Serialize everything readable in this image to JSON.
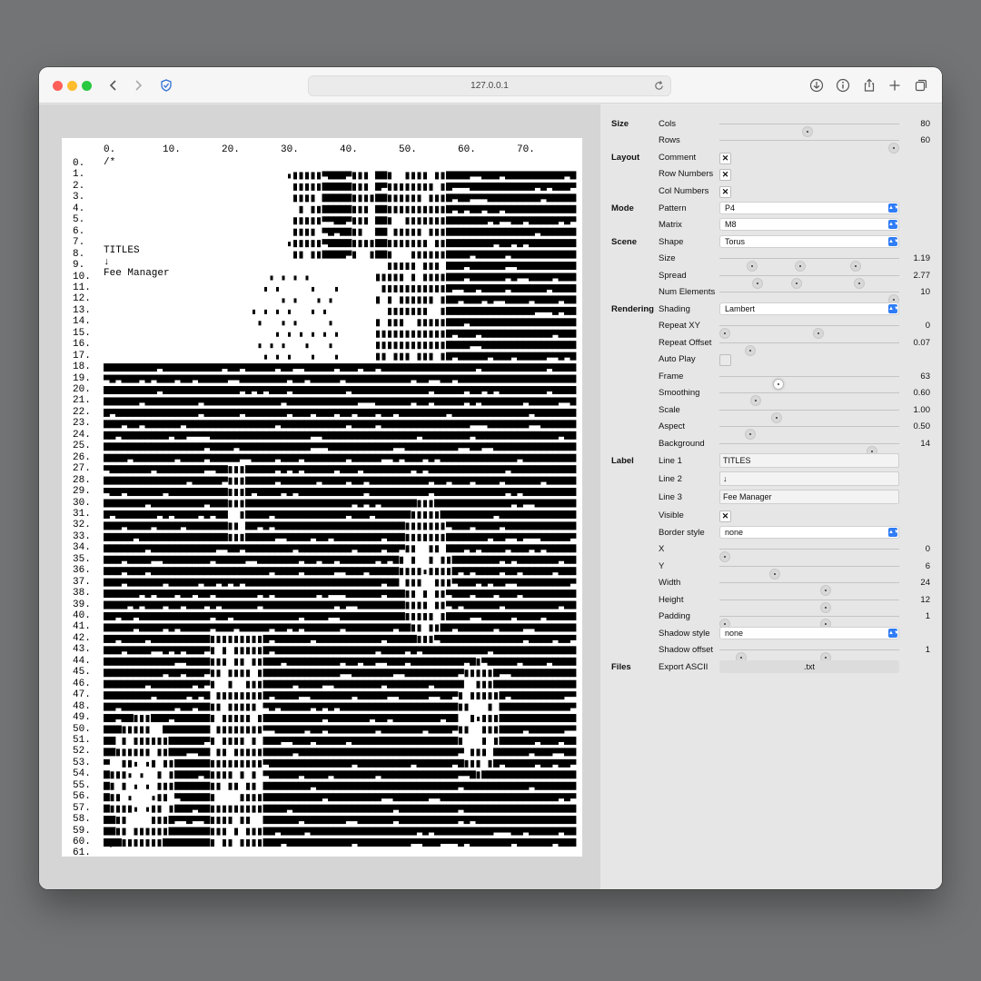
{
  "browser": {
    "url": "127.0.0.1"
  },
  "canvas": {
    "col_ticks": [
      "0.",
      "10.",
      "20.",
      "30.",
      "40.",
      "50.",
      "60.",
      "70."
    ],
    "row_numbers": [
      "0.",
      "1.",
      "2.",
      "3.",
      "4.",
      "5.",
      "6.",
      "7.",
      "8.",
      "9.",
      "10.",
      "11.",
      "12.",
      "13.",
      "14.",
      "15.",
      "16.",
      "17.",
      "18.",
      "19.",
      "20.",
      "21.",
      "22.",
      "23.",
      "24.",
      "25.",
      "26.",
      "27.",
      "28.",
      "29.",
      "30.",
      "31.",
      "32.",
      "33.",
      "34.",
      "35.",
      "36.",
      "37.",
      "38.",
      "39.",
      "40.",
      "41.",
      "42.",
      "43.",
      "44.",
      "45.",
      "46.",
      "47.",
      "48.",
      "49.",
      "50.",
      "51.",
      "52.",
      "53.",
      "54.",
      "55.",
      "56.",
      "57.",
      "58.",
      "59.",
      "60.",
      "61."
    ],
    "comment_open": "/*",
    "comment_close": "*/",
    "label_line1": "TITLES",
    "label_line2": "↓",
    "label_line3": "Fee Manager"
  },
  "panel": {
    "size": {
      "section": "Size",
      "cols": {
        "label": "Cols",
        "value": "80"
      },
      "rows": {
        "label": "Rows",
        "value": "60"
      }
    },
    "layout": {
      "section": "Layout",
      "comment": {
        "label": "Comment",
        "checked": true
      },
      "row_numbers": {
        "label": "Row Numbers",
        "checked": true
      },
      "col_numbers": {
        "label": "Col Numbers",
        "checked": true
      }
    },
    "mode": {
      "section": "Mode",
      "pattern": {
        "label": "Pattern",
        "value": "P4"
      },
      "matrix": {
        "label": "Matrix",
        "value": "M8"
      }
    },
    "scene": {
      "section": "Scene",
      "shape": {
        "label": "Shape",
        "value": "Torus"
      },
      "size": {
        "label": "Size",
        "value": "1.19"
      },
      "spread": {
        "label": "Spread",
        "value": "2.77"
      },
      "num_elements": {
        "label": "Num Elements",
        "value": "10"
      }
    },
    "rendering": {
      "section": "Rendering",
      "shading": {
        "label": "Shading",
        "value": "Lambert"
      },
      "repeat_xy": {
        "label": "Repeat XY",
        "value": "0"
      },
      "repeat_offset": {
        "label": "Repeat Offset",
        "value": "0.07"
      },
      "auto_play": {
        "label": "Auto Play",
        "checked": false
      },
      "frame": {
        "label": "Frame",
        "value": "63"
      },
      "smoothing": {
        "label": "Smoothing",
        "value": "0.60"
      },
      "scale": {
        "label": "Scale",
        "value": "1.00"
      },
      "aspect": {
        "label": "Aspect",
        "value": "0.50"
      },
      "background": {
        "label": "Background",
        "value": "14"
      }
    },
    "label": {
      "section": "Label",
      "line1": {
        "label": "Line 1",
        "value": "TITLES"
      },
      "line2": {
        "label": "Line 2",
        "value": "↓"
      },
      "line3": {
        "label": "Line 3",
        "value": "Fee Manager"
      },
      "visible": {
        "label": "Visible",
        "checked": true
      },
      "border_style": {
        "label": "Border style",
        "value": "none"
      },
      "x": {
        "label": "X",
        "value": "0"
      },
      "y": {
        "label": "Y",
        "value": "6"
      },
      "width": {
        "label": "Width",
        "value": "24"
      },
      "height": {
        "label": "Height",
        "value": "12"
      },
      "padding": {
        "label": "Padding",
        "value": "1"
      },
      "shadow_style": {
        "label": "Shadow style",
        "value": "none"
      },
      "shadow_offset": {
        "label": "Shadow offset",
        "value": "1"
      }
    },
    "files": {
      "section": "Files",
      "export_ascii": {
        "label": "Export ASCII",
        "button": ".txt"
      }
    }
  }
}
